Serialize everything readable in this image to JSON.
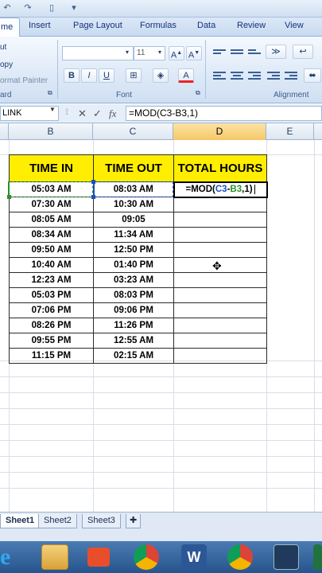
{
  "ribbon": {
    "tabs": [
      "me",
      "Insert",
      "Page Layout",
      "Formulas",
      "Data",
      "Review",
      "View"
    ],
    "clipboard": {
      "cut": "ut",
      "copy": "opy",
      "format_painter": "ormat Painter",
      "label": "ard"
    },
    "font": {
      "name": "",
      "size": "11",
      "label": "Font",
      "bold": "B",
      "italic": "I",
      "underline": "U"
    },
    "alignment": {
      "label": "Alignment"
    }
  },
  "formula_bar": {
    "name_box": "LINK",
    "cancel": "✕",
    "enter": "✓",
    "fx": "fx",
    "formula": "=MOD(C3-B3,1)"
  },
  "columns": [
    "B",
    "C",
    "D",
    "E"
  ],
  "table": {
    "headers": [
      "TIME IN",
      "TIME OUT",
      "TOTAL HOURS"
    ],
    "rows": [
      [
        "05:03 AM",
        "08:03 AM"
      ],
      [
        "07:30 AM",
        "10:30 AM"
      ],
      [
        "08:05 AM",
        "09:05"
      ],
      [
        "08:34 AM",
        "11:34 AM"
      ],
      [
        "09:50 AM",
        "12:50 PM"
      ],
      [
        "10:40 AM",
        "01:40 PM"
      ],
      [
        "12:23 AM",
        "03:23 AM"
      ],
      [
        "05:03 PM",
        "08:03 PM"
      ],
      [
        "07:06 PM",
        "09:06 PM"
      ],
      [
        "08:26 PM",
        "11:26 PM"
      ],
      [
        "09:55 PM",
        "12:55 AM"
      ],
      [
        "11:15 PM",
        "02:15 AM"
      ]
    ],
    "editing_cell": {
      "prefix": "=MOD(",
      "ref1": "C3",
      "minus": "-",
      "ref2": "B3",
      "suffix": ",1)"
    }
  },
  "sheets": [
    "Sheet1",
    "Sheet2",
    "Sheet3"
  ],
  "colors": {
    "header_fill": "#ffee00",
    "ref_c": "#1c4fc2",
    "ref_b": "#2b8f2b"
  }
}
